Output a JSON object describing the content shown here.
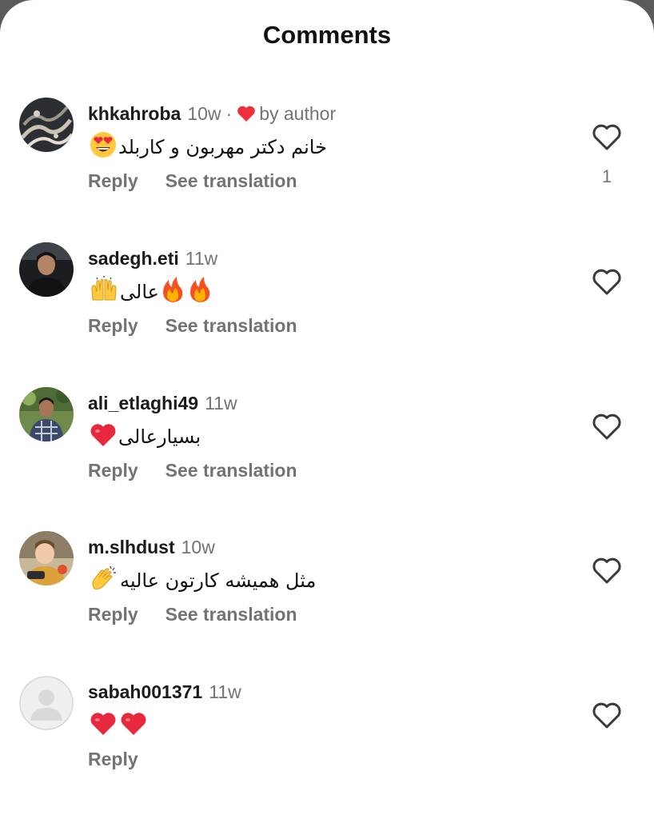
{
  "header": {
    "title": "Comments"
  },
  "action_labels": {
    "reply": "Reply",
    "see_translation": "See translation"
  },
  "author_badge": {
    "separator": "·",
    "label": "by author",
    "heart_color": "#ed2f3c"
  },
  "comments": [
    {
      "username": "khkahroba",
      "time": "10w",
      "text": "خانم دکتر مهربون و کاربلد",
      "emojis": [
        "heart-eyes-emoji"
      ],
      "liked_by_author": true,
      "like_count": "1",
      "has_translation": true
    },
    {
      "username": "sadegh.eti",
      "time": "11w",
      "text": "عالی",
      "emojis": [
        "fire-emoji",
        "fire-emoji",
        "raised-hands-emoji"
      ],
      "liked_by_author": false,
      "like_count": "",
      "has_translation": true
    },
    {
      "username": "ali_etlaghi49",
      "time": "11w",
      "text": "بسیارعالی",
      "emojis": [
        "red-heart-emoji"
      ],
      "liked_by_author": false,
      "like_count": "",
      "has_translation": true
    },
    {
      "username": "m.slhdust",
      "time": "10w",
      "text": "مثل همیشه کارتون عالیه",
      "emojis": [
        "clapping-hands-emoji"
      ],
      "liked_by_author": false,
      "like_count": "",
      "has_translation": true
    },
    {
      "username": "sabah001371",
      "time": "11w",
      "text": "",
      "emojis": [
        "red-heart-emoji",
        "red-heart-emoji"
      ],
      "liked_by_author": false,
      "like_count": "",
      "has_translation": false
    }
  ]
}
